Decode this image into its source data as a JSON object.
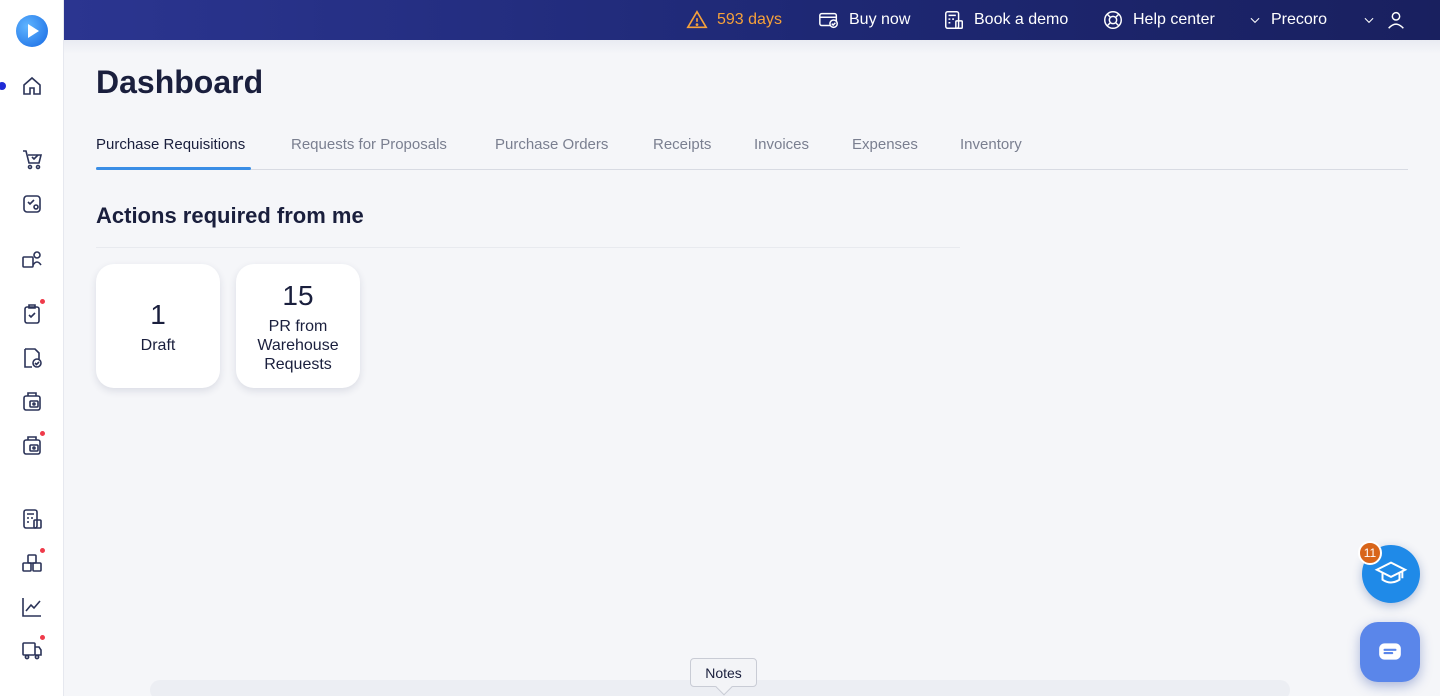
{
  "topbar": {
    "trial_days": "593 days",
    "buy_now": "Buy now",
    "book_demo": "Book a demo",
    "help_center": "Help center",
    "company": "Precoro"
  },
  "page": {
    "title": "Dashboard"
  },
  "tabs": [
    {
      "label": "Purchase Requisitions",
      "active": true
    },
    {
      "label": "Requests for Proposals",
      "active": false
    },
    {
      "label": "Purchase Orders",
      "active": false
    },
    {
      "label": "Receipts",
      "active": false
    },
    {
      "label": "Invoices",
      "active": false
    },
    {
      "label": "Expenses",
      "active": false
    },
    {
      "label": "Inventory",
      "active": false
    }
  ],
  "actions": {
    "title": "Actions required from me",
    "cards": [
      {
        "count": "1",
        "label": "Draft"
      },
      {
        "count": "15",
        "label": "PR from Warehouse Requests"
      }
    ]
  },
  "sidebar": {
    "icons": [
      {
        "name": "home-icon",
        "badge": false
      },
      {
        "name": "shopping-cart-icon",
        "badge": false
      },
      {
        "name": "requisition-icon",
        "badge": false
      },
      {
        "name": "suppliers-icon",
        "badge": false
      },
      {
        "name": "approvals-icon",
        "badge": true
      },
      {
        "name": "purchase-order-icon",
        "badge": false
      },
      {
        "name": "receipt-icon",
        "badge": false
      },
      {
        "name": "invoice-icon",
        "badge": true
      },
      {
        "name": "budget-icon",
        "badge": false
      },
      {
        "name": "inventory-icon",
        "badge": true
      },
      {
        "name": "analytics-icon",
        "badge": false
      },
      {
        "name": "warehouse-icon",
        "badge": true
      }
    ]
  },
  "learning_badge": "11",
  "notes_label": "Notes",
  "colors": {
    "topbar": "#1e2874",
    "accent": "#3a8ee6",
    "trial": "#f6a13a",
    "badge_red": "#ef3b4a"
  }
}
